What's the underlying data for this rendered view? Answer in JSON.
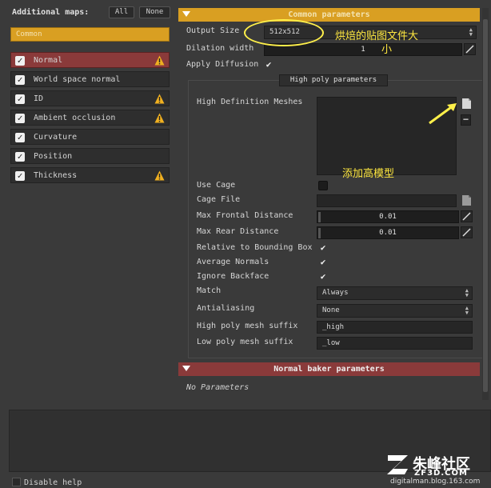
{
  "left": {
    "title": "Additional maps:",
    "btn_all": "All",
    "btn_none": "None",
    "preset": "Common",
    "maps": [
      {
        "label": "Normal",
        "checked": true,
        "warning": true,
        "active": true
      },
      {
        "label": "World space normal",
        "checked": true,
        "warning": false
      },
      {
        "label": "ID",
        "checked": true,
        "warning": true
      },
      {
        "label": "Ambient occlusion",
        "checked": true,
        "warning": true
      },
      {
        "label": "Curvature",
        "checked": true,
        "warning": false
      },
      {
        "label": "Position",
        "checked": true,
        "warning": false
      },
      {
        "label": "Thickness",
        "checked": true,
        "warning": true
      }
    ]
  },
  "common": {
    "header": "Common parameters",
    "output_size_label": "Output Size",
    "output_size_value": "512x512",
    "dilation_label": "Dilation width",
    "dilation_value": "1",
    "apply_diffusion_label": "Apply Diffusion",
    "apply_diffusion": true
  },
  "highpoly": {
    "title": "High poly parameters",
    "meshes_label": "High Definition Meshes",
    "use_cage_label": "Use Cage",
    "cage_file_label": "Cage File",
    "max_frontal_label": "Max Frontal Distance",
    "max_frontal_value": "0.01",
    "max_rear_label": "Max Rear Distance",
    "max_rear_value": "0.01",
    "relative_bbox_label": "Relative to Bounding Box",
    "average_normals_label": "Average Normals",
    "ignore_backface_label": "Ignore Backface",
    "match_label": "Match",
    "match_value": "Always",
    "antialiasing_label": "Antialiasing",
    "antialiasing_value": "None",
    "hp_suffix_label": "High poly mesh suffix",
    "hp_suffix_value": "_high",
    "lp_suffix_label": "Low poly mesh suffix",
    "lp_suffix_value": "_low"
  },
  "normal_baker": {
    "header": "Normal baker parameters",
    "no_params": "No Parameters"
  },
  "help": {
    "disable_help": "Disable help"
  },
  "annotations": {
    "size_note": "烘焙的贴图文件大",
    "size_note_2": "小",
    "add_highpoly_note": "添加高模型"
  },
  "watermark": {
    "brand": "朱峰社区",
    "sub": "ZF3D.COM",
    "url": "digitalman.blog.163.com"
  },
  "colors": {
    "accent_orange": "#d99f22",
    "accent_red": "#8a3a3a",
    "annotation_yellow": "#ffe840"
  }
}
